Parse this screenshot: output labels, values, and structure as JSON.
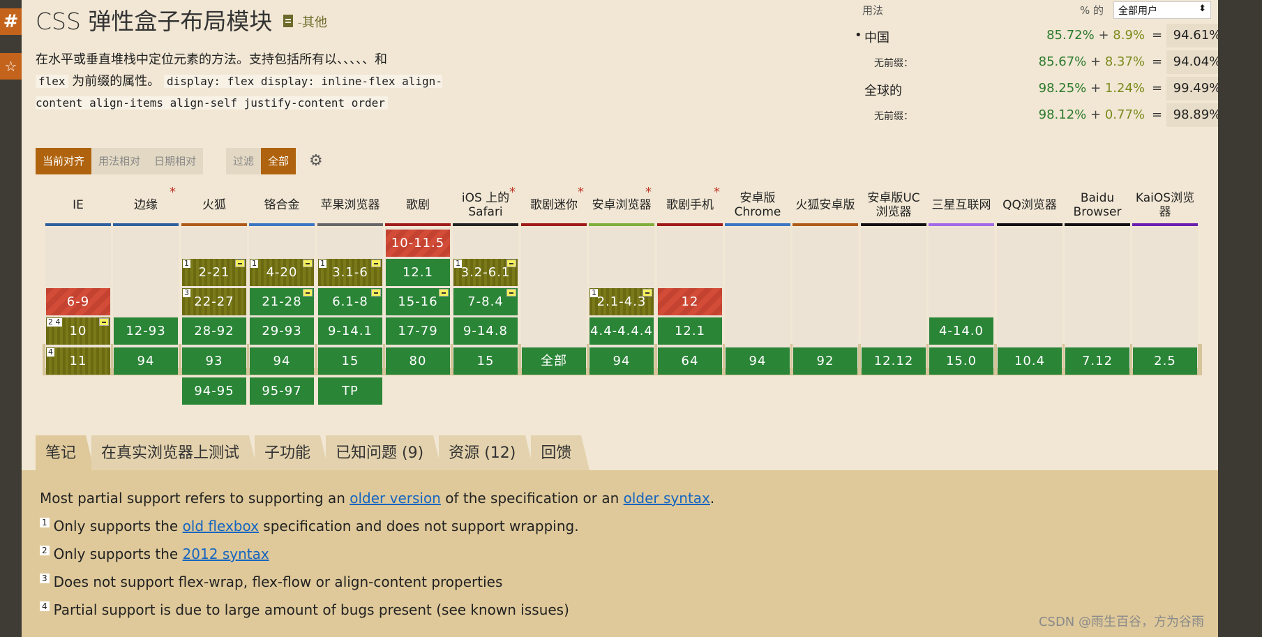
{
  "sidebar": {
    "hash_label": "#",
    "star_label": "☆"
  },
  "header": {
    "title": "CSS 弹性盒子布局模块",
    "status": "-其他"
  },
  "description": {
    "line1": "在水平或垂直堆栈中定位元素的方法。支持包括所有以、、、、、和",
    "code1": "flex",
    "line2": "为前缀的属性。",
    "code_list": "display: flex display: inline-flex align-content align-items align-self justify-content order"
  },
  "usage": {
    "header": "用法",
    "pct_label": "% 的",
    "select_value": "全部用户",
    "help": "?",
    "rows": [
      {
        "label": "中国",
        "bullet": "•",
        "supported": "85.72%",
        "partial": "8.9%",
        "total": "94.61%"
      },
      {
        "label": "无前缀：",
        "supported": "85.67%",
        "partial": "8.37%",
        "total": "94.04%"
      },
      {
        "label": "全球的",
        "supported": "98.25%",
        "partial": "1.24%",
        "total": "99.49%"
      },
      {
        "label": "无前缀：",
        "supported": "98.12%",
        "partial": "0.77%",
        "total": "98.89%"
      }
    ]
  },
  "view_buttons": [
    "当前对齐",
    "用法相对",
    "日期相对"
  ],
  "filter_buttons": [
    "过滤",
    "全部"
  ],
  "settings_icon": "gear-icon",
  "browsers": [
    {
      "name": "IE",
      "star": false,
      "color": "#2e5fa0",
      "cells": [
        {
          "row": 2,
          "text": "6-9",
          "type": "n"
        },
        {
          "row": 3,
          "text": "10",
          "type": "a",
          "note": "2 4",
          "flag": true
        },
        {
          "row": 4,
          "text": "11",
          "type": "a",
          "note": "4"
        }
      ]
    },
    {
      "name": "边缘",
      "star": true,
      "color": "#2e5fa0",
      "cells": [
        {
          "row": 3,
          "text": "12-93",
          "type": "y"
        },
        {
          "row": 4,
          "text": "94",
          "type": "y"
        }
      ]
    },
    {
      "name": "火狐",
      "star": false,
      "color": "#b05a1a",
      "cells": [
        {
          "row": 1,
          "text": "2-21",
          "type": "a",
          "note": "1",
          "flag": true
        },
        {
          "row": 2,
          "text": "22-27",
          "type": "a",
          "note": "3"
        },
        {
          "row": 3,
          "text": "28-92",
          "type": "y"
        },
        {
          "row": 4,
          "text": "93",
          "type": "y"
        },
        {
          "row": 5,
          "text": "94-95",
          "type": "y"
        }
      ]
    },
    {
      "name": "铬合金",
      "star": false,
      "color": "#3b76c4",
      "cells": [
        {
          "row": 1,
          "text": "4-20",
          "type": "a",
          "note": "1",
          "flag": true
        },
        {
          "row": 2,
          "text": "21-28",
          "type": "y",
          "flag": true
        },
        {
          "row": 3,
          "text": "29-93",
          "type": "y"
        },
        {
          "row": 4,
          "text": "94",
          "type": "y"
        },
        {
          "row": 5,
          "text": "95-97",
          "type": "y"
        }
      ]
    },
    {
      "name": "苹果浏览器",
      "star": false,
      "color": "#666666",
      "cells": [
        {
          "row": 1,
          "text": "3.1-6",
          "type": "a",
          "note": "1",
          "flag": true
        },
        {
          "row": 2,
          "text": "6.1-8",
          "type": "y",
          "flag": true
        },
        {
          "row": 3,
          "text": "9-14.1",
          "type": "y"
        },
        {
          "row": 4,
          "text": "15",
          "type": "y"
        },
        {
          "row": 5,
          "text": "TP",
          "type": "y"
        }
      ]
    },
    {
      "name": "歌剧",
      "star": false,
      "color": "#a01a1a",
      "cells": [
        {
          "row": 0,
          "text": "10-11.5",
          "type": "n"
        },
        {
          "row": 1,
          "text": "12.1",
          "type": "y"
        },
        {
          "row": 2,
          "text": "15-16",
          "type": "y",
          "flag": true
        },
        {
          "row": 3,
          "text": "17-79",
          "type": "y"
        },
        {
          "row": 4,
          "text": "80",
          "type": "y"
        }
      ]
    },
    {
      "name": "iOS 上的 Safari",
      "star": true,
      "color": "#222222",
      "cells": [
        {
          "row": 1,
          "text": "3.2-6.1",
          "type": "a",
          "note": "1",
          "flag": true
        },
        {
          "row": 2,
          "text": "7-8.4",
          "type": "y",
          "flag": true
        },
        {
          "row": 3,
          "text": "9-14.8",
          "type": "y"
        },
        {
          "row": 4,
          "text": "15",
          "type": "y"
        }
      ]
    },
    {
      "name": "歌剧迷你",
      "star": true,
      "color": "#a01a1a",
      "cells": [
        {
          "row": 4,
          "text": "全部",
          "type": "y"
        }
      ]
    },
    {
      "name": "安卓浏览器",
      "star": true,
      "color": "#7fae3b",
      "cells": [
        {
          "row": 2,
          "text": "2.1-4.3",
          "type": "a",
          "note": "1",
          "flag": true
        },
        {
          "row": 3,
          "text": "4.4-4.4.4",
          "type": "y"
        },
        {
          "row": 4,
          "text": "94",
          "type": "y"
        }
      ]
    },
    {
      "name": "歌剧手机",
      "star": true,
      "color": "#a01a1a",
      "cells": [
        {
          "row": 2,
          "text": "12",
          "type": "n"
        },
        {
          "row": 3,
          "text": "12.1",
          "type": "y"
        },
        {
          "row": 4,
          "text": "64",
          "type": "y"
        }
      ]
    },
    {
      "name": "安卓版 Chrome",
      "star": false,
      "color": "#3b76c4",
      "cells": [
        {
          "row": 4,
          "text": "94",
          "type": "y"
        }
      ]
    },
    {
      "name": "火狐安卓版",
      "star": false,
      "color": "#b05a1a",
      "cells": [
        {
          "row": 4,
          "text": "92",
          "type": "y"
        }
      ]
    },
    {
      "name": "安卓版UC 浏览器",
      "star": false,
      "color": "#111111",
      "cells": [
        {
          "row": 4,
          "text": "12.12",
          "type": "y"
        }
      ]
    },
    {
      "name": "三星互联网",
      "star": false,
      "color": "#a36ae8",
      "cells": [
        {
          "row": 3,
          "text": "4-14.0",
          "type": "y"
        },
        {
          "row": 4,
          "text": "15.0",
          "type": "y"
        }
      ]
    },
    {
      "name": "QQ浏览器",
      "star": false,
      "color": "#111111",
      "cells": [
        {
          "row": 4,
          "text": "10.4",
          "type": "y"
        }
      ]
    },
    {
      "name": "Baidu Browser",
      "star": false,
      "color": "#111111",
      "cells": [
        {
          "row": 4,
          "text": "7.12",
          "type": "y"
        }
      ]
    },
    {
      "name": "KaiOS浏览器",
      "star": false,
      "color": "#6a1fb0",
      "cells": [
        {
          "row": 4,
          "text": "2.5",
          "type": "y"
        }
      ]
    }
  ],
  "tabs": [
    "笔记",
    "在真实浏览器上测试",
    "子功能",
    "已知问题 (9)",
    "资源 (12)",
    "回馈"
  ],
  "notes": {
    "main_pre": "Most partial support refers to supporting an ",
    "main_link1": "older version",
    "main_mid": " of the specification or an ",
    "main_link2": "older syntax",
    "main_post": ".",
    "n1_num": "1",
    "n1_pre": "Only supports the ",
    "n1_link": "old flexbox",
    "n1_post": " specification and does not support wrapping.",
    "n2_num": "2",
    "n2_pre": "Only supports the ",
    "n2_link": "2012 syntax",
    "n3_num": "3",
    "n3_text": "Does not support flex-wrap, flex-flow or align-content properties",
    "n4_num": "4",
    "n4_text": "Partial support is due to large amount of bugs present (see known issues)"
  },
  "watermark": "CSDN @雨生百谷，方为谷雨"
}
